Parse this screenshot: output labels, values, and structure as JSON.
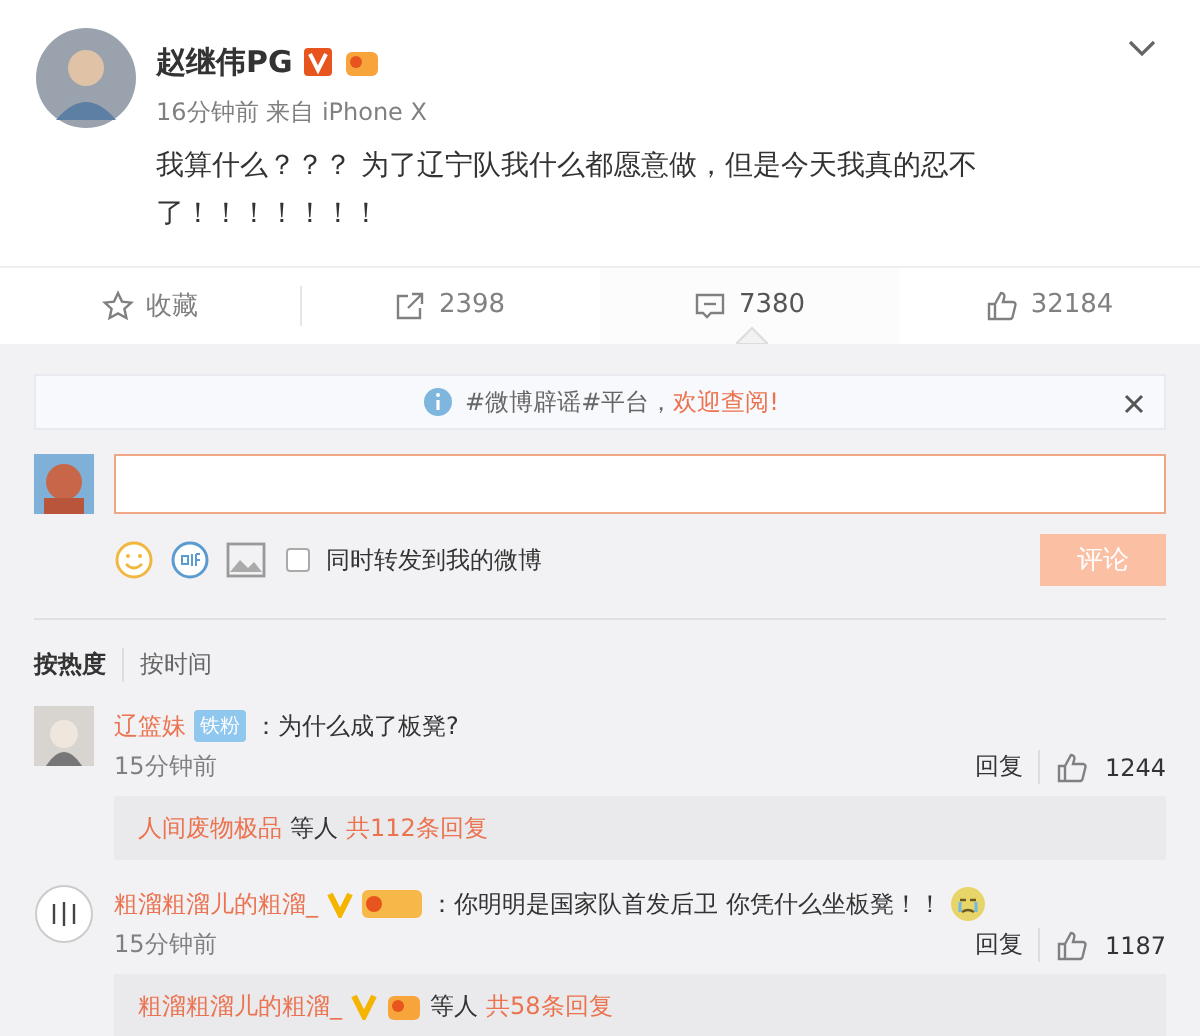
{
  "post": {
    "author": "赵继伟PG",
    "time": "16分钟前",
    "source_prefix": "来自",
    "source": "iPhone X",
    "text": "我算什么？？？ 为了辽宁队我什么都愿意做，但是今天我真的忍不了！！！！！！！"
  },
  "actions": [
    {
      "kind": "favorite",
      "label": "收藏",
      "selected": false
    },
    {
      "kind": "repost",
      "label": "2398",
      "selected": false
    },
    {
      "kind": "comment",
      "label": "7380",
      "selected": true
    },
    {
      "kind": "like",
      "label": "32184",
      "selected": false
    }
  ],
  "notice": {
    "tag": "#微博辟谣#平台，",
    "link": "欢迎查阅!"
  },
  "composer": {
    "repost_label": "同时转发到我的微博",
    "repost_checked": false,
    "submit": "评论"
  },
  "sort_tabs": [
    {
      "label": "按热度",
      "selected": true
    },
    {
      "label": "按时间",
      "selected": false
    }
  ],
  "comments": [
    {
      "author": "辽篮妹",
      "vip": false,
      "badge": "铁粉",
      "text": "：为什么成了板凳?",
      "emoji": false,
      "time": "15分钟前",
      "reply": "回复",
      "likes": "1244",
      "replies": {
        "who": "人间废物极品",
        "who_vip": false,
        "others": "等人",
        "count": "共112条回复"
      }
    },
    {
      "author": "粗溜粗溜儿的粗溜_",
      "vip": true,
      "text": "：你明明是国家队首发后卫 你凭什么坐板凳！！",
      "emoji": true,
      "time": "15分钟前",
      "reply": "回复",
      "likes": "1187",
      "replies": {
        "who": "粗溜粗溜儿的粗溜_",
        "who_vip": true,
        "others": "等人",
        "count": "共58条回复"
      }
    }
  ]
}
